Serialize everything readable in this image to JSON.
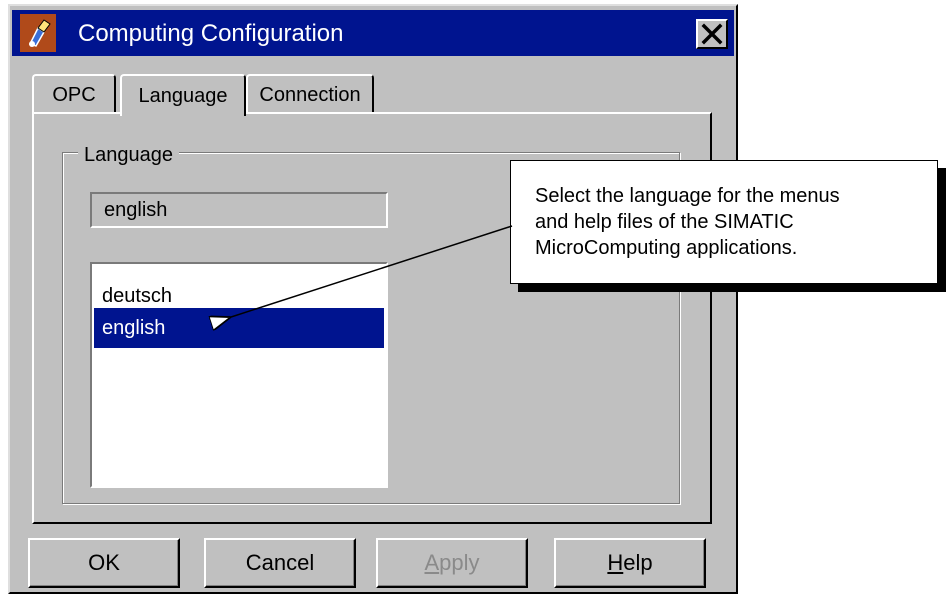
{
  "window": {
    "title": "Computing Configuration"
  },
  "tabs": [
    {
      "label": "OPC",
      "active": false
    },
    {
      "label": "Language",
      "active": true
    },
    {
      "label": "Connection",
      "active": false
    }
  ],
  "language_group": {
    "legend": "Language",
    "current_value": "english",
    "options": [
      {
        "label": "deutsch",
        "selected": false
      },
      {
        "label": "english",
        "selected": true
      }
    ]
  },
  "buttons": {
    "ok": "OK",
    "cancel": "Cancel",
    "apply_mnemonic": "A",
    "apply_rest": "pply",
    "apply_enabled": false,
    "help_mnemonic": "H",
    "help_rest": "elp"
  },
  "callout": {
    "lines": [
      "Select the language for the menus",
      "and help files of the SIMATIC",
      "MicroComputing applications."
    ]
  },
  "colors": {
    "titlebar": "#00148f",
    "selection": "#00148f",
    "face": "#c0c0c0"
  },
  "icons": {
    "app": "application-icon",
    "close": "close-icon"
  }
}
